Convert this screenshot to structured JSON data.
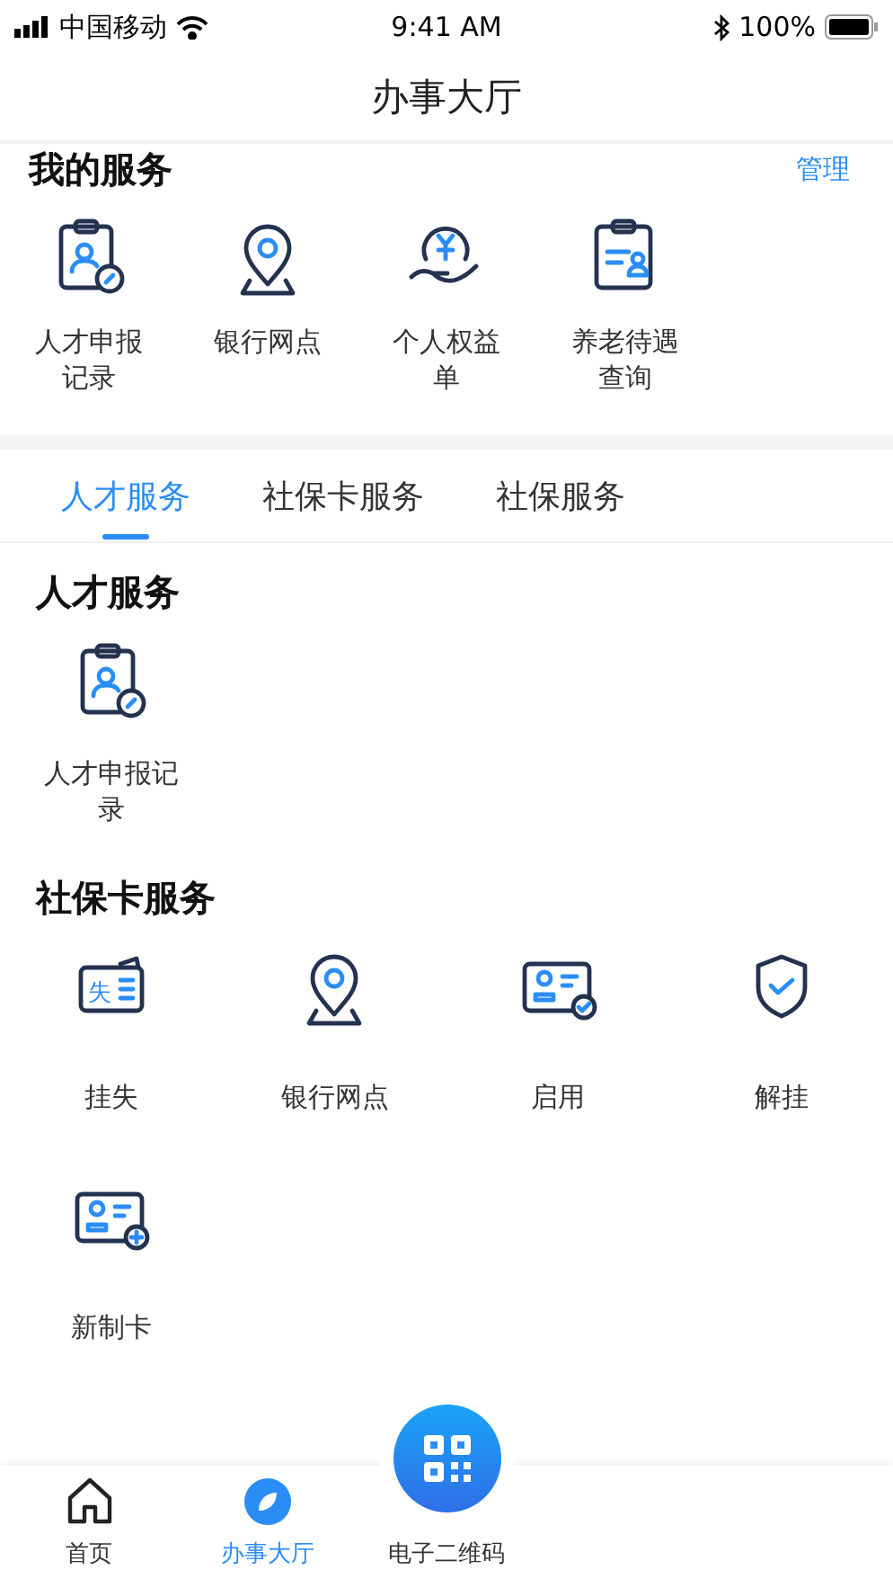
{
  "status_bar": {
    "carrier": "中国移动",
    "time": "9:41 AM",
    "battery": "100%"
  },
  "nav": {
    "title": "办事大厅"
  },
  "my_services": {
    "title": "我的服务",
    "action": "管理",
    "items": [
      {
        "label": "人才申报记录"
      },
      {
        "label": "银行网点"
      },
      {
        "label": "个人权益单"
      },
      {
        "label": "养老待遇查询"
      }
    ]
  },
  "tabs": [
    {
      "label": "人才服务",
      "selected": true
    },
    {
      "label": "社保卡服务",
      "selected": false
    },
    {
      "label": "社保服务",
      "selected": false
    }
  ],
  "sections": [
    {
      "title": "人才服务",
      "items": [
        {
          "label": "人才申报记录"
        }
      ]
    },
    {
      "title": "社保卡服务",
      "items": [
        {
          "label": "挂失",
          "icon_text": "失"
        },
        {
          "label": "银行网点"
        },
        {
          "label": "启用"
        },
        {
          "label": "解挂"
        },
        {
          "label": "新制卡"
        }
      ]
    }
  ],
  "bottom_nav": [
    {
      "label": "首页",
      "selected": false
    },
    {
      "label": "办事大厅",
      "selected": true
    },
    {
      "label": "电子二维码",
      "selected": false
    }
  ]
}
